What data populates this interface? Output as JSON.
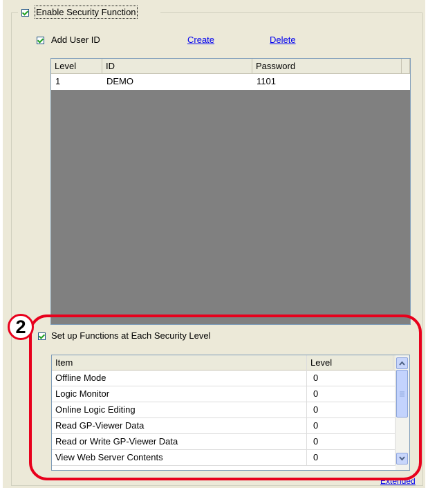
{
  "security": {
    "enable_label": "Enable Security Function",
    "enable_checked": true
  },
  "user_id": {
    "add_label": "Add User ID",
    "add_checked": true,
    "create_link": "Create",
    "delete_link": "Delete",
    "columns": [
      "Level",
      "ID",
      "Password"
    ],
    "rows": [
      {
        "level": "1",
        "id": "DEMO",
        "password": "1101"
      }
    ]
  },
  "callout": {
    "number": "2"
  },
  "functions": {
    "setup_label": "Set up Functions at Each Security Level",
    "setup_checked": true,
    "columns": [
      "Item",
      "Level"
    ],
    "rows": [
      {
        "item": "Offline Mode",
        "level": "0"
      },
      {
        "item": "Logic Monitor",
        "level": "0"
      },
      {
        "item": "Online Logic Editing",
        "level": "0"
      },
      {
        "item": "Read GP-Viewer Data",
        "level": "0"
      },
      {
        "item": "Read or Write GP-Viewer Data",
        "level": "0"
      },
      {
        "item": "View Web Server Contents",
        "level": "0"
      }
    ]
  },
  "footer": {
    "extended_link": "Extended"
  },
  "colors": {
    "highlight": "#e8001c",
    "link": "#0000ee",
    "dialog_bg": "#ece9d8"
  }
}
